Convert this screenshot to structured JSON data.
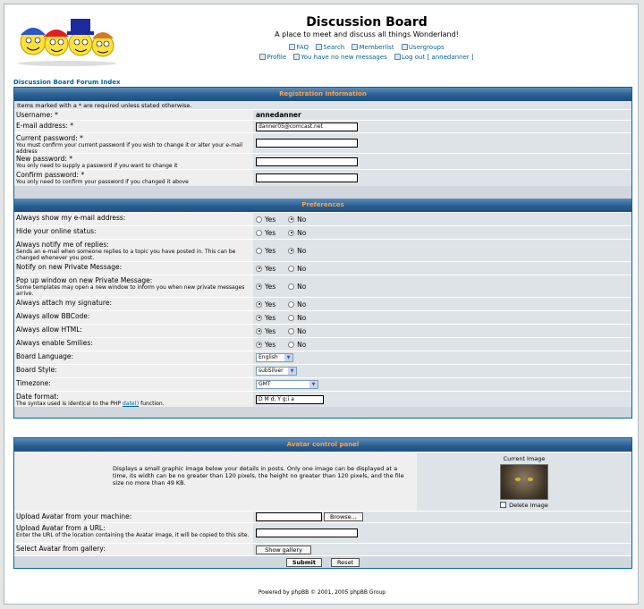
{
  "header": {
    "title": "Discussion Board",
    "description": "A place to meet and discuss all things Wonderland!",
    "nav_row1": [
      {
        "label": "FAQ",
        "icon": "faq-icon"
      },
      {
        "label": "Search",
        "icon": "search-icon"
      },
      {
        "label": "Memberlist",
        "icon": "memberlist-icon"
      },
      {
        "label": "Usergroups",
        "icon": "usergroups-icon"
      }
    ],
    "nav_row2": [
      {
        "label": "Profile",
        "icon": "profile-icon"
      },
      {
        "label": "You have no new messages",
        "icon": "messages-icon"
      },
      {
        "label": "Log out [ annedanner ]",
        "icon": "logout-icon"
      }
    ]
  },
  "breadcrumb": "Discussion Board Forum Index",
  "registration": {
    "header": "Registration Information",
    "note": "Items marked with a * are required unless stated otherwise.",
    "username_label": "Username: *",
    "username_value": "annedanner",
    "email_label": "E-mail address: *",
    "email_value": "danner05@comcast.net",
    "current_pw_label": "Current password: *",
    "current_pw_explain": "You must confirm your current password if you wish to change it or alter your e-mail address",
    "new_pw_label": "New password: *",
    "new_pw_explain": "You only need to supply a password if you want to change it",
    "confirm_pw_label": "Confirm password: *",
    "confirm_pw_explain": "You only need to confirm your password if you changed it above"
  },
  "preferences": {
    "header": "Preferences",
    "yes": "Yes",
    "no": "No",
    "items": [
      {
        "label": "Always show my e-mail address:",
        "explain": "",
        "value": "no"
      },
      {
        "label": "Hide your online status:",
        "explain": "",
        "value": "no"
      },
      {
        "label": "Always notify me of replies:",
        "explain": "Sends an e-mail when someone replies to a topic you have posted in. This can be changed whenever you post.",
        "value": "no"
      },
      {
        "label": "Notify on new Private Message:",
        "explain": "",
        "value": "yes"
      },
      {
        "label": "Pop up window on new Private Message:",
        "explain": "Some templates may open a new window to inform you when new private messages arrive.",
        "value": "yes"
      },
      {
        "label": "Always attach my signature:",
        "explain": "",
        "value": "yes"
      },
      {
        "label": "Always allow BBCode:",
        "explain": "",
        "value": "yes"
      },
      {
        "label": "Always allow HTML:",
        "explain": "",
        "value": "yes"
      },
      {
        "label": "Always enable Smilies:",
        "explain": "",
        "value": "yes"
      }
    ],
    "language_label": "Board Language:",
    "language_value": "English",
    "style_label": "Board Style:",
    "style_value": "subSilver",
    "timezone_label": "Timezone:",
    "timezone_value": "GMT",
    "date_label": "Date format:",
    "date_explain_pre": "The syntax used is identical to the PHP",
    "date_explain_link": "date()",
    "date_explain_post": "function.",
    "date_value": "D M d, Y g:i a"
  },
  "avatar": {
    "header": "Avatar control panel",
    "description": "Displays a small graphic image below your details in posts. Only one image can be displayed at a time, its width can be no greater than 120 pixels, the height no greater than 120 pixels, and the file size no more than 49 KB.",
    "current_label": "Current Image",
    "delete_label": "Delete Image",
    "upload_label": "Upload Avatar from your machine:",
    "browse_label": "Browse...",
    "url_label": "Upload Avatar from a URL:",
    "url_explain": "Enter the URL of the location containing the Avatar image, it will be copied to this site.",
    "gallery_label": "Select Avatar from gallery:",
    "gallery_button": "Show gallery"
  },
  "actions": {
    "submit": "Submit",
    "reset": "Reset"
  },
  "footer": "Powered by phpBB © 2001, 2005 phpBB Group"
}
